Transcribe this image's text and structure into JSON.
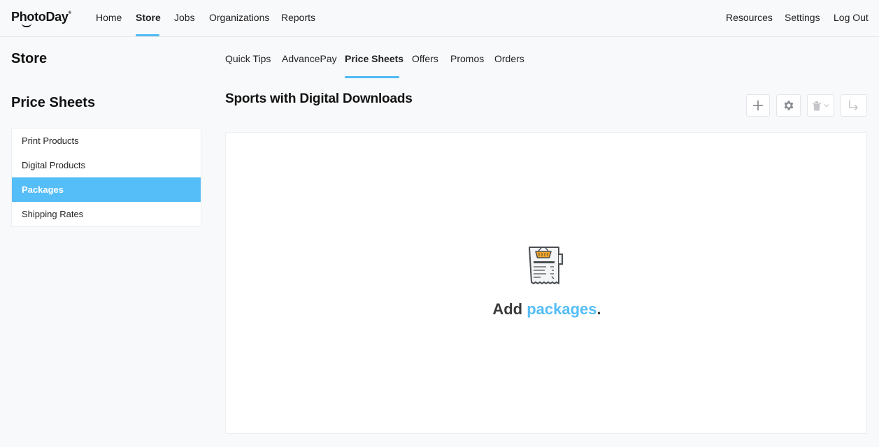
{
  "app": {
    "logo_text": "PhotoDay",
    "logo_mark": "®"
  },
  "topnav": {
    "left_links": [
      "Home",
      "Store",
      "Jobs",
      "Organizations",
      "Reports"
    ],
    "active": "Store",
    "right_links": [
      "Resources",
      "Settings",
      "Log Out"
    ]
  },
  "sidebar": {
    "section_title": "Store",
    "subsection_title": "Price Sheets",
    "items": [
      {
        "label": "Print Products",
        "active": false
      },
      {
        "label": "Digital Products",
        "active": false
      },
      {
        "label": "Packages",
        "active": true
      },
      {
        "label": "Shipping Rates",
        "active": false
      }
    ]
  },
  "subtabs": {
    "items": [
      "Quick Tips",
      "AdvancePay",
      "Price Sheets",
      "Offers",
      "Promos",
      "Orders"
    ],
    "active": "Price Sheets"
  },
  "main": {
    "title": "Sports with Digital Downloads",
    "toolbar": {
      "icons": [
        "plus-icon",
        "gear-icon",
        "trash-icon",
        "chevron-down-icon",
        "arrow-return-icon"
      ]
    },
    "empty_state": {
      "icon": "receipt-basket-icon",
      "prefix": "Add ",
      "link": "packages",
      "suffix": "."
    }
  },
  "colors": {
    "accent": "#55bdf7",
    "underline": "#4fbaf6",
    "background": "#f8f9fb",
    "text": "#1f1f1f"
  }
}
